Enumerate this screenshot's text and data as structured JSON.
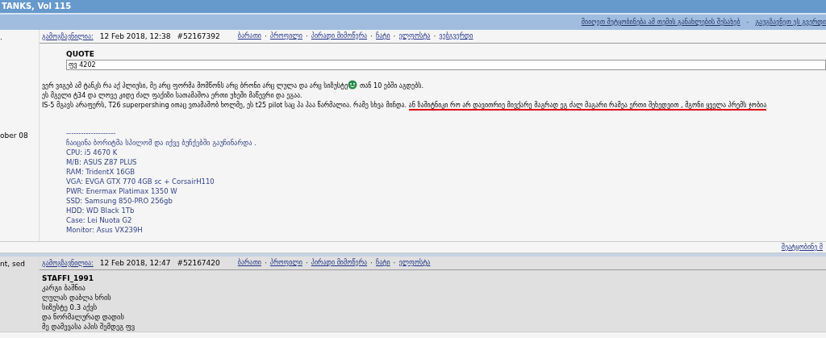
{
  "topic_title": "TANKS, Vol 115",
  "separator": "·",
  "topic_links": [
    "მიიღეთ შეტყობინება ამ თემის განახლების შესახებ",
    "გაუგზავნეთ ეს გვერდი"
  ],
  "posts": [
    {
      "author_info": [
        ".",
        "ober 08"
      ],
      "sent_label": "გამოგზავნილია:",
      "date": "12 Feb 2018, 12:38",
      "post_id": "#52167392",
      "links": [
        "ბარათი",
        "პროფილი",
        "პირადი მიმოწერა",
        "ჩატი",
        "ელფოსტა",
        "ვებგვერდი"
      ],
      "quote": {
        "title": "QUOTE",
        "text": "ფვ 4202"
      },
      "body": [
        {
          "kind": "text",
          "text": "ვერ ვიგებ ამ ტანკს რა აქ პლიუსი, მე არც ფორმა მომწონს არც ბრონი არც ლულა და არც სიზუსტე"
        },
        {
          "kind": "emoji"
        },
        {
          "kind": "text",
          "text": " თან 10 ებში აგდებს."
        },
        {
          "kind": "break"
        },
        {
          "kind": "text",
          "text": "ეს მგელი ტ34 და ლოვე კიდე ძალ ფაქიზი სათამაშოა ერთი უხეში მაწევრი და ეგაა."
        },
        {
          "kind": "break"
        },
        {
          "kind": "text",
          "text": "IS-5 მგავს არაფერს, T26 superpershing ითაც ვთამაშობ ხოლმე, ეს t25 pilot საც ჰა ჰაა წარმალია. რამე სხვა მიჩდა. "
        },
        {
          "kind": "underlined",
          "text": "ან ზაშიტნიკი რო არ დავითრიე მივქარე მაგრად ეგ ძალ მაგარი რამეა ერთი შეხედვით , მგონი ყველა პრემს ჯობია"
        }
      ],
      "signature": [
        "--------------------",
        "ჩაიცინა ბორიტმა სპილომ და იქვე ბუჩქებში გაუჩინარდა .",
        "CPU: i5 4670 K",
        "M/B: ASUS Z87 PLUS",
        "RAM: TridentX 16GB",
        "VGA: EVGA GTX 770 4GB sc + CorsairH110",
        "PWR: Enermax Platimax 1350 W",
        "SSD: Samsung 850-PRO 256gb",
        "HDD: WD Black 1Tb",
        "Case: Lei Nuota G2",
        "Monitor: Asus VX239H"
      ],
      "report_link": "შეატყობინე მ"
    },
    {
      "author_info": [
        "nt, sed"
      ],
      "sent_label": "გამოგზავნილია:",
      "date": "12 Feb 2018, 12:47",
      "post_id": "#52167420",
      "links": [
        "ბარათი",
        "პროფილი",
        "პირადი მიმოწერა",
        "ჩატი",
        "ელფოსტა"
      ],
      "body_title": "STAFFI_1991",
      "lines": [
        "კარგი ბაშნია",
        "ლულას დაბლა ხრის",
        "სიზუსტე 0.3 აქვს",
        "და ნორმალურად დადის",
        "მე დამევასა აპის შემდეგ ფვ"
      ]
    }
  ]
}
